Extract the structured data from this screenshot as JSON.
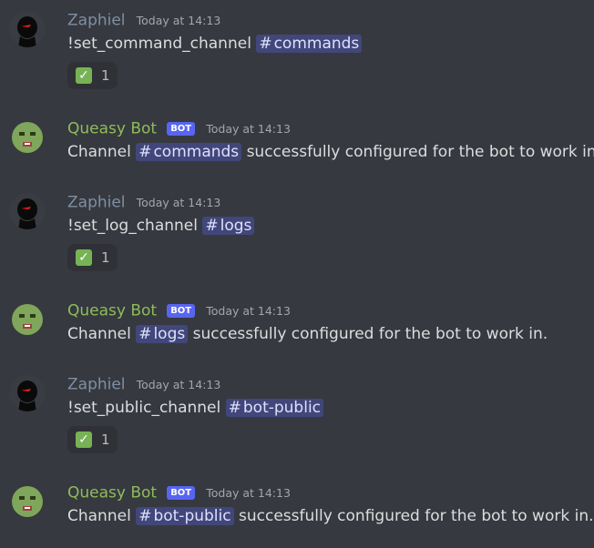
{
  "messages": [
    {
      "author": "Zaphiel",
      "time": "Today at 14:13",
      "command": "!set_command_channel",
      "channel": "commands",
      "reaction": {
        "emoji": "✓",
        "count": "1"
      }
    },
    {
      "author": "Queasy Bot",
      "bot_tag": "BOT",
      "time": "Today at 14:13",
      "prefix": "Channel",
      "channel": "commands",
      "suffix": "successfully configured for the bot to work in."
    },
    {
      "author": "Zaphiel",
      "time": "Today at 14:13",
      "command": "!set_log_channel",
      "channel": "logs",
      "reaction": {
        "emoji": "✓",
        "count": "1"
      }
    },
    {
      "author": "Queasy Bot",
      "bot_tag": "BOT",
      "time": "Today at 14:13",
      "prefix": "Channel",
      "channel": "logs",
      "suffix": "successfully configured for the bot to work in."
    },
    {
      "author": "Zaphiel",
      "time": "Today at 14:13",
      "command": "!set_public_channel",
      "channel": "bot-public",
      "reaction": {
        "emoji": "✓",
        "count": "1"
      }
    },
    {
      "author": "Queasy Bot",
      "bot_tag": "BOT",
      "time": "Today at 14:13",
      "prefix": "Channel",
      "channel": "bot-public",
      "suffix": "successfully configured for the bot to work in."
    }
  ],
  "mention_prefix": "#",
  "colors": {
    "background": "#36393f",
    "zaphiel_name": "#7f8fa3",
    "bot_name": "#8fbc5b",
    "bot_tag": "#5865f2",
    "mention_bg": "#4b4f8a",
    "reaction_bg": "#2f3136",
    "check_green": "#77b255"
  },
  "icons": {
    "zaphiel_avatar": "dark-silhouette-red-eye-avatar",
    "bot_avatar": "green-face-avatar",
    "reaction": "white-check-mark-icon"
  }
}
